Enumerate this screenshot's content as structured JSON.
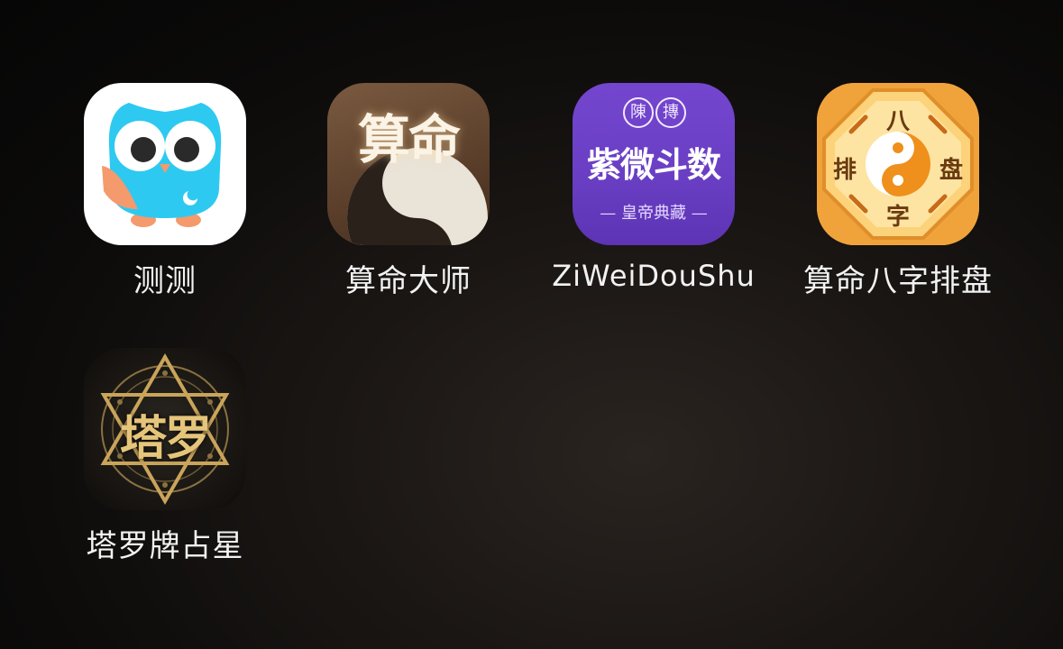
{
  "apps": [
    {
      "label": "测测",
      "icon": "owl-icon"
    },
    {
      "label": "算命大师",
      "icon": "yin-yang-fortune-icon",
      "icon_text": "算命"
    },
    {
      "label": "ZiWeiDouShu",
      "icon": "ziwei-doushu-icon",
      "icon_text": "紫微斗数",
      "icon_subtext": "— 皇帝典藏 —",
      "icon_seal_1": "陳",
      "icon_seal_2": "摶"
    },
    {
      "label": "算命八字排盘",
      "icon": "bagua-icon",
      "icon_chars": [
        "八",
        "排",
        "盘",
        "字"
      ]
    },
    {
      "label": "塔罗牌占星",
      "icon": "tarot-hexagram-icon",
      "icon_text": "塔罗"
    }
  ],
  "colors": {
    "owl_bg": "#ffffff",
    "owl_body": "#2ec9f0",
    "owl_wing": "#f49a6c",
    "fortune_bg": "#6b4a33",
    "ziwei_bg": "#6a3fc4",
    "bagua_bg": "#f2a53a",
    "tarot_bg": "#1d1a16",
    "tarot_gold": "#c9a45a"
  }
}
